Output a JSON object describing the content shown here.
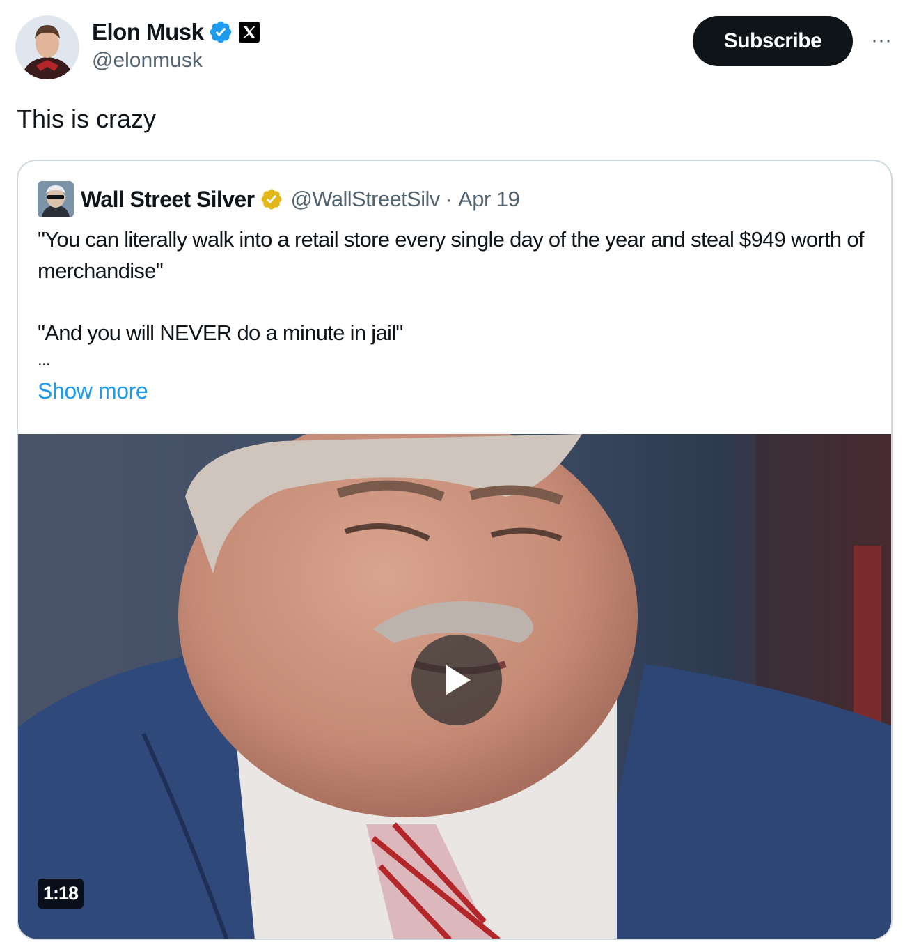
{
  "post": {
    "author_name": "Elon Musk",
    "author_handle": "@elonmusk",
    "affiliate_icon": "x-logo-icon",
    "verified_icon": "verified-badge-icon",
    "subscribe_label": "Subscribe",
    "more_icon": "more-icon",
    "more_label": "···",
    "text": "This is crazy"
  },
  "quoted": {
    "author_name": "Wall Street Silver",
    "author_handle": "@WallStreetSilv",
    "separator": "·",
    "date": "Apr 19",
    "badge_icon": "gold-verified-badge-icon",
    "lines": [
      "\"You can literally walk into a retail store every single day of the year and steal $949 worth of merchandise\"",
      "\"And you will NEVER do a minute in jail\""
    ],
    "ellipsis": "...",
    "show_more": "Show more",
    "video": {
      "duration": "1:18",
      "play_icon": "play-icon"
    }
  },
  "colors": {
    "link": "#1d9bf0",
    "verified_blue": "#1d9bf0",
    "verified_gold": "#e2b719",
    "secondary_text": "#536471",
    "button_dark": "#0f1419"
  }
}
